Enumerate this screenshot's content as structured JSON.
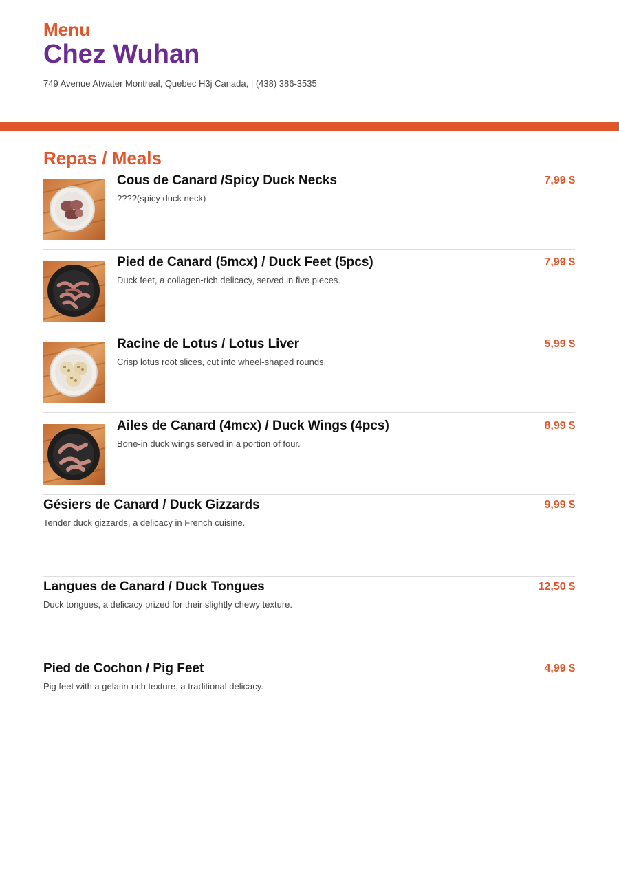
{
  "header": {
    "menu_label": "Menu",
    "restaurant_name": "Chez Wuhan",
    "address": "749 Avenue Atwater Montreal, Quebec H3j Canada, | (438) 386-3535"
  },
  "colors": {
    "accent": "#e0562b",
    "brand": "#6a2c91"
  },
  "section": {
    "title": "Repas / Meals",
    "items": [
      {
        "name": "Cous de Canard /Spicy Duck Necks",
        "description": "????(spicy duck neck)",
        "price": "7,99 $",
        "photo": "duck-necks-photo"
      },
      {
        "name": "Pied de Canard (5mcx) / Duck Feet (5pcs)",
        "description": "Duck feet, a collagen-rich delicacy, served in five pieces.",
        "price": "7,99 $",
        "photo": "duck-feet-photo"
      },
      {
        "name": "Racine de Lotus / Lotus Liver",
        "description": "Crisp lotus root slices, cut into wheel-shaped rounds.",
        "price": "5,99 $",
        "photo": "lotus-root-photo"
      },
      {
        "name": "Ailes de Canard (4mcx) / Duck Wings (4pcs)",
        "description": "Bone-in duck wings served in a portion of four.",
        "price": "8,99 $",
        "photo": "duck-wings-photo"
      },
      {
        "name": "Gésiers de Canard / Duck Gizzards",
        "description": "Tender duck gizzards, a delicacy in French cuisine.",
        "price": "9,99 $"
      },
      {
        "name": "Langues de Canard / Duck Tongues",
        "description": "Duck tongues, a delicacy prized for their slightly chewy texture.",
        "price": "12,50 $"
      },
      {
        "name": "Pied de Cochon / Pig Feet",
        "description": "Pig feet with a gelatin-rich texture, a traditional delicacy.",
        "price": "4,99 $"
      }
    ]
  }
}
